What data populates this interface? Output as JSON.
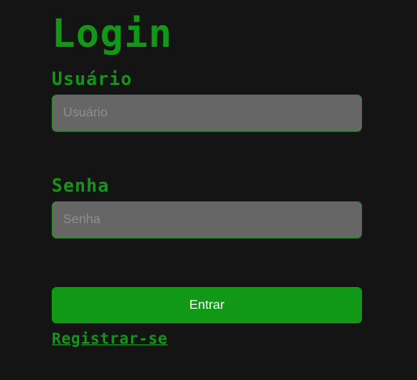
{
  "login": {
    "title": "Login",
    "username": {
      "label": "Usuário",
      "placeholder": "Usuário",
      "value": ""
    },
    "password": {
      "label": "Senha",
      "placeholder": "Senha",
      "value": ""
    },
    "submit_label": "Entrar",
    "register_link": "Registrar-se"
  },
  "colors": {
    "background": "#141414",
    "accent": "#129817",
    "input_background": "#666666",
    "placeholder": "#8f8f8f",
    "button_text": "#ffffff"
  }
}
